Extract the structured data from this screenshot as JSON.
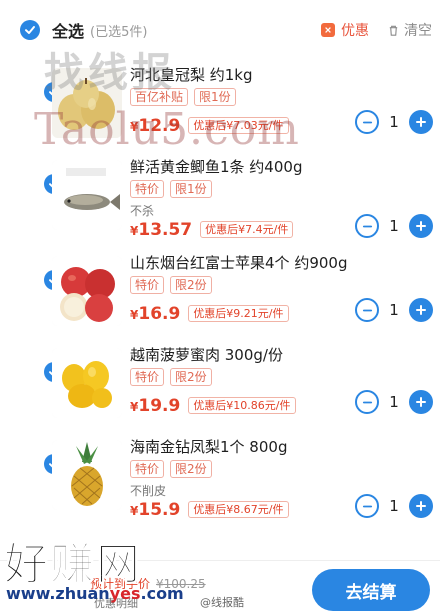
{
  "header": {
    "select_all": "全选",
    "selected_count": "(已选5件)",
    "promo_label": "优惠",
    "clear_label": "清空"
  },
  "items": [
    {
      "title": "河北皇冠梨 约1kg",
      "tags": [
        "百亿补贴",
        "限1份"
      ],
      "note": "",
      "price_symbol": "¥",
      "price": "12.9",
      "after_promo": "优惠后¥7.03元/件",
      "quantity": "1",
      "image": "pear"
    },
    {
      "title": "鲜活黄金鲫鱼1条 约400g",
      "tags": [
        "特价",
        "限1份"
      ],
      "note": "不杀",
      "price_symbol": "¥",
      "price": "13.57",
      "after_promo": "优惠后¥7.4元/件",
      "quantity": "1",
      "image": "fish"
    },
    {
      "title": "山东烟台红富士苹果4个 约900g",
      "tags": [
        "特价",
        "限2份"
      ],
      "note": "",
      "price_symbol": "¥",
      "price": "16.9",
      "after_promo": "优惠后¥9.21元/件",
      "quantity": "1",
      "image": "apple"
    },
    {
      "title": "越南菠萝蜜肉 300g/份",
      "tags": [
        "特价",
        "限2份"
      ],
      "note": "",
      "price_symbol": "¥",
      "price": "19.9",
      "after_promo": "优惠后¥10.86元/件",
      "quantity": "1",
      "image": "jackfruit"
    },
    {
      "title": "海南金钻凤梨1个 800g",
      "tags": [
        "特价",
        "限2份"
      ],
      "note": "不削皮",
      "price_symbol": "¥",
      "price": "15.9",
      "after_promo": "优惠后¥8.67元/件",
      "quantity": "1",
      "image": "pineapple"
    }
  ],
  "footer": {
    "total_label": "预计到手价",
    "original_total": "¥100.25",
    "detail_link": "优惠明细",
    "checkout_label": "去结算"
  },
  "watermarks": {
    "top": "找线报",
    "site": "Taolu5.com",
    "bottom_logo": "好赚网",
    "bottom_url_a": "www.zhuan",
    "bottom_url_b": "yes",
    "bottom_url_c": ".com",
    "weibo": "@线报酷"
  },
  "colors": {
    "accent": "#2a86e2",
    "price": "#e2432a"
  }
}
